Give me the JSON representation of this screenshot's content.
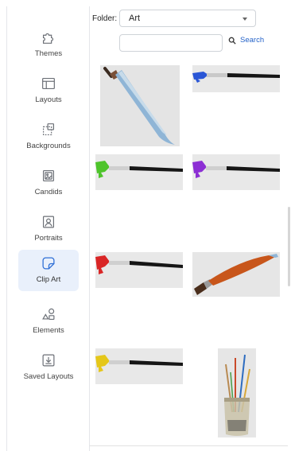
{
  "sidebar": {
    "items": [
      {
        "label": "Themes",
        "icon": "puzzle-icon"
      },
      {
        "label": "Layouts",
        "icon": "layout-icon"
      },
      {
        "label": "Backgrounds",
        "icon": "background-icon"
      },
      {
        "label": "Candids",
        "icon": "image-icon"
      },
      {
        "label": "Portraits",
        "icon": "portrait-icon"
      },
      {
        "label": "Clip Art",
        "icon": "sticker-icon",
        "active": true
      },
      {
        "label": "Elements",
        "icon": "shapes-icon"
      },
      {
        "label": "Saved Layouts",
        "icon": "download-icon"
      }
    ]
  },
  "toolbar": {
    "folder_label": "Folder:",
    "folder_value": "Art",
    "search_value": "",
    "search_label": "Search"
  },
  "gallery": {
    "items": [
      {
        "name": "paintbrush-blue-grey",
        "accent": "#8fb5d6"
      },
      {
        "name": "paintbrush-blue",
        "accent": "#2a56d6"
      },
      {
        "name": "paintbrush-green",
        "accent": "#4ec42b"
      },
      {
        "name": "paintbrush-purple",
        "accent": "#8c2fd4"
      },
      {
        "name": "paintbrush-red",
        "accent": "#d92626"
      },
      {
        "name": "paintbrush-orange",
        "accent": "#c8561b"
      },
      {
        "name": "paintbrush-yellow",
        "accent": "#e5c71a"
      },
      {
        "name": "brushes-in-jar",
        "accent": "#b88a52"
      }
    ]
  },
  "colors": {
    "accent_link": "#2563c9",
    "active_nav_bg": "#e9f0fb"
  }
}
